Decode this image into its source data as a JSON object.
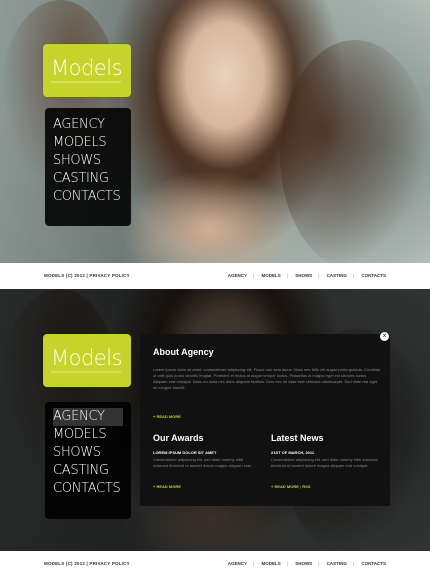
{
  "brand": {
    "logo_text": "Models",
    "logo_color": "#c6d32a"
  },
  "menu": [
    "AGENCY",
    "MODELS",
    "SHOWS",
    "CASTING",
    "CONTACTS"
  ],
  "footer": {
    "copyright": "MODELS (C) 2012",
    "separator": "|",
    "privacy": "PRIVACY POLICY",
    "links": [
      "AGENCY",
      "MODELS",
      "SHOWS",
      "CASTING",
      "CONTACTS"
    ]
  },
  "panel": {
    "close_glyph": "×",
    "about_title": "About Agency",
    "about_text": "Lorem ipsum dolor sit amet, consectetuer adipiscing elit. Fusce non sem lacus. Nunc nec felis vel augue porta gravida. Curabitur ut velit quis purus lobortis feugiat. Praesent et lectus at augue tempor luctus. Phasellus ut magna eget est ultricies luctus. Aliquam erat volutpat. Nunc eu nulla nec dolor aliquam facilisis. Duis nec mi vitae erat vehicula ullamcorper. Sed vitae nisl eget mi congue blandit.",
    "read_more": "READ MORE",
    "awards_title": "Our Awards",
    "awards_subtitle": "LOREM IPSUM DOLOR SIT AMET",
    "awards_text": "Consectetuer adipiscing elit, sed diam nummy nibh euismod tincidunt ut laoreet dolore magna aliquam erat.",
    "news_title": "Latest News",
    "news_date": "21ST OF MARCH, 2011",
    "news_text": "Consectetuer adipiscing elit, sed diam nummy nibh euismod tincidunt ut laoreet dolore magna aliquam erat volutpat.",
    "news_more": "READ MORE",
    "news_sep": "|",
    "news_rss": "RSS"
  }
}
